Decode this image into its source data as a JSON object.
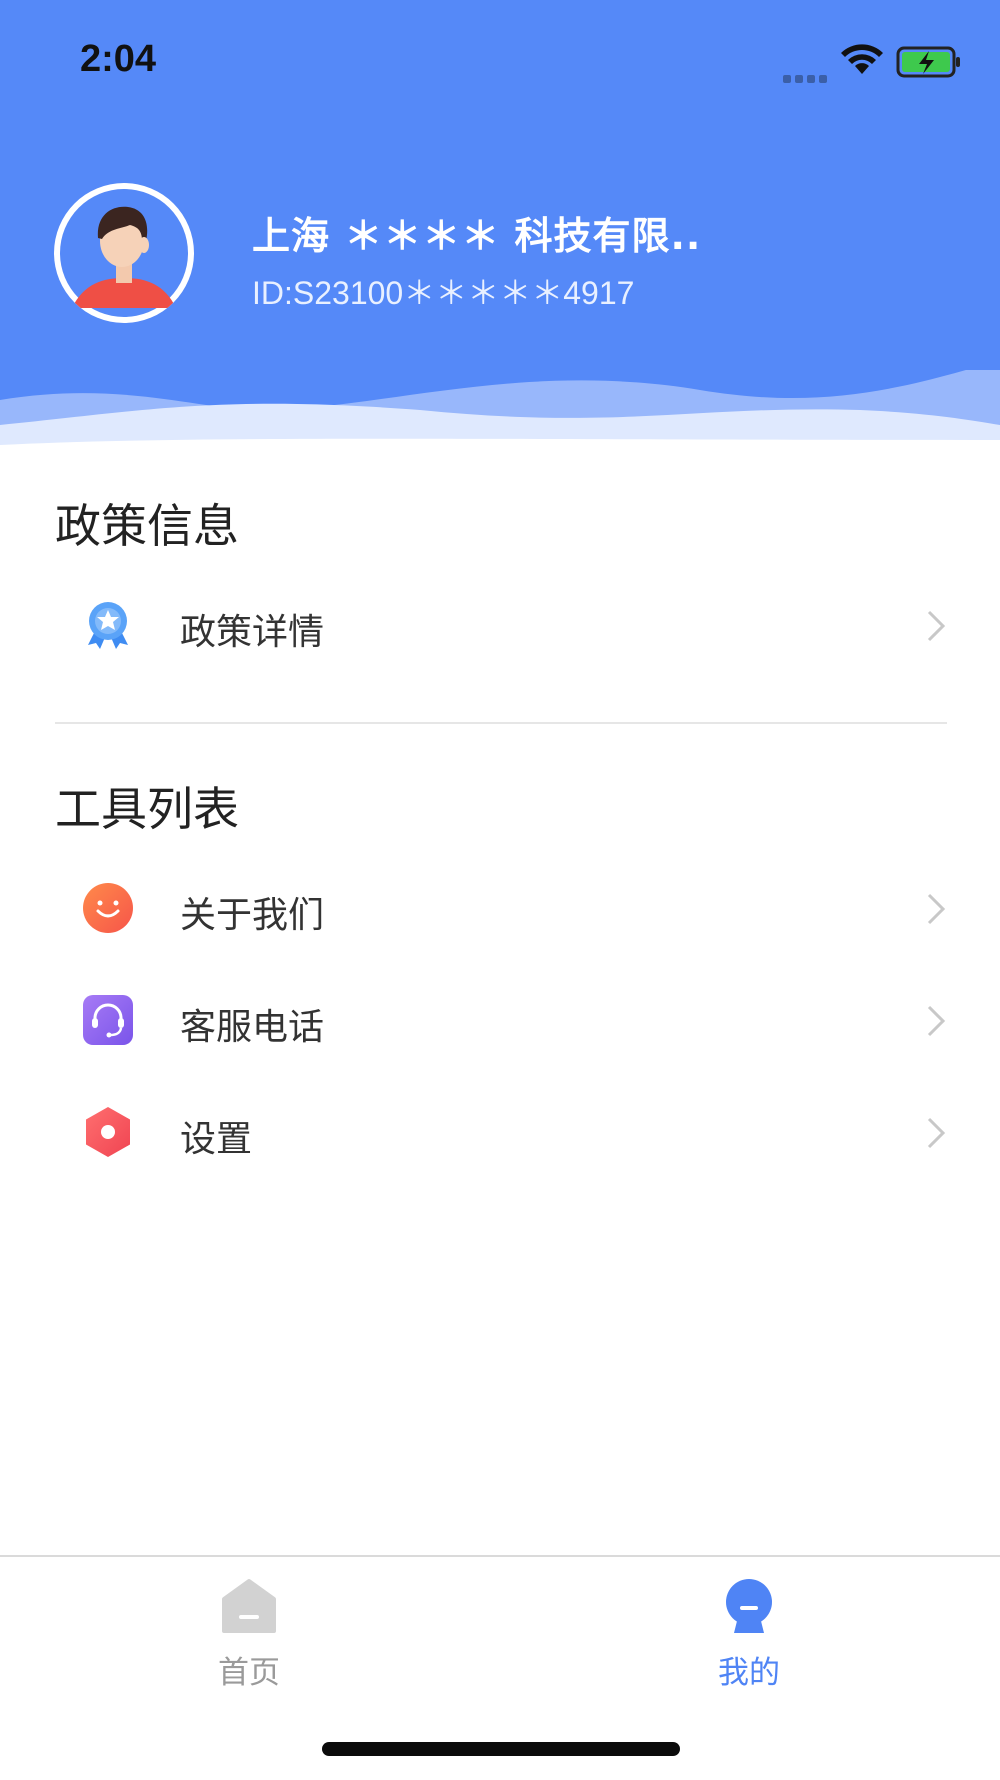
{
  "status_bar": {
    "time": "2:04"
  },
  "profile": {
    "company_name": "上海 ＊＊＊＊ 科技有限..",
    "user_id": "ID:S23100＊＊＊＊＊4917"
  },
  "sections": {
    "policy": {
      "title": "政策信息",
      "items": [
        {
          "label": "政策详情",
          "icon": "ribbon-badge-icon"
        }
      ]
    },
    "tools": {
      "title": "工具列表",
      "items": [
        {
          "label": "关于我们",
          "icon": "smiley-icon"
        },
        {
          "label": "客服电话",
          "icon": "headset-icon"
        },
        {
          "label": "设置",
          "icon": "hexagon-gear-icon"
        }
      ]
    }
  },
  "tab_bar": {
    "tabs": [
      {
        "label": "首页",
        "icon": "home-icon",
        "active": false
      },
      {
        "label": "我的",
        "icon": "profile-icon",
        "active": true
      }
    ]
  },
  "colors": {
    "header_blue": "#5589f8",
    "active_tab": "#4f84f5",
    "inactive_tab": "#9a9a9a"
  }
}
